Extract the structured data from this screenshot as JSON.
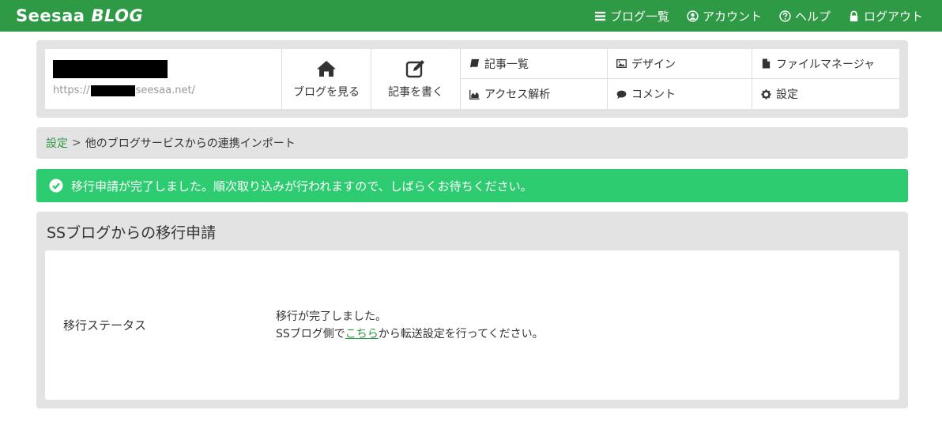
{
  "topbar": {
    "logo_left": "Seesaa",
    "logo_right": "BLOG",
    "nav": [
      {
        "label": "ブログ一覧",
        "icon": "list-icon"
      },
      {
        "label": "アカウント",
        "icon": "user-circle-icon"
      },
      {
        "label": "ヘルプ",
        "icon": "question-circle-icon"
      },
      {
        "label": "ログアウト",
        "icon": "lock-icon"
      }
    ]
  },
  "blog": {
    "url_prefix": "https://",
    "url_suffix": "seesaa.net/",
    "view_label": "ブログを見る",
    "write_label": "記事を書く"
  },
  "menu": [
    {
      "label": "記事一覧",
      "icon": "book-icon"
    },
    {
      "label": "デザイン",
      "icon": "image-icon"
    },
    {
      "label": "ファイルマネージャ",
      "icon": "file-icon"
    },
    {
      "label": "アクセス解析",
      "icon": "area-chart-icon"
    },
    {
      "label": "コメント",
      "icon": "comments-icon"
    },
    {
      "label": "設定",
      "icon": "gear-icon"
    }
  ],
  "breadcrumb": {
    "link": "設定",
    "separator": ">",
    "current": "他のブログサービスからの連携インポート"
  },
  "alert": {
    "message": "移行申請が完了しました。順次取り込みが行われますので、しばらくお待ちください。",
    "color": "#2ecc71"
  },
  "section": {
    "title": "SSブログからの移行申請",
    "status_label": "移行ステータス",
    "status_line1": "移行が完了しました。",
    "status_line2_prefix": "SSブログ側で",
    "status_line2_link": "こちら",
    "status_line2_suffix": "から転送設定を行ってください。"
  },
  "colors": {
    "brand": "#2f9a45",
    "panel": "#e3e3e3"
  }
}
